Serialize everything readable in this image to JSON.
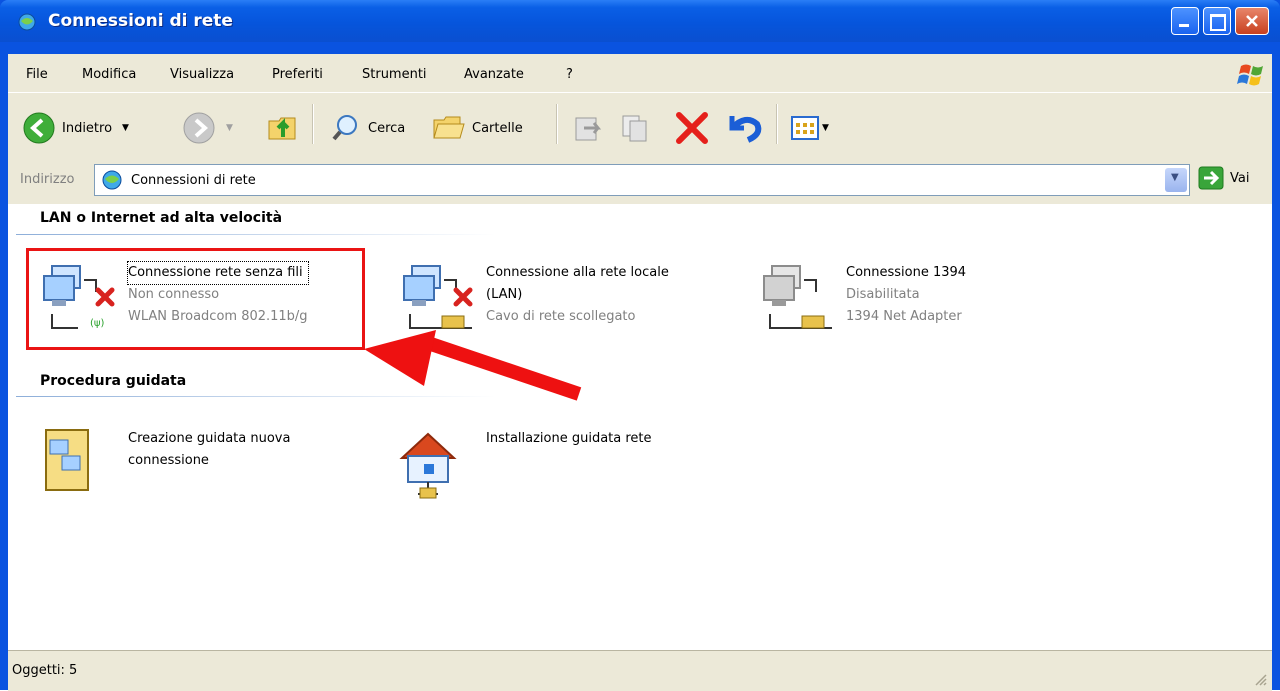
{
  "window": {
    "title": "Connessioni di rete"
  },
  "menu": [
    "File",
    "Modifica",
    "Visualizza",
    "Preferiti",
    "Strumenti",
    "Avanzate",
    "?"
  ],
  "toolbar": {
    "back_label": "Indietro",
    "search_label": "Cerca",
    "folders_label": "Cartelle"
  },
  "address": {
    "label": "Indirizzo",
    "value": "Connessioni di rete",
    "go_label": "Vai"
  },
  "groups": [
    {
      "title": "LAN o Internet ad alta velocità",
      "items": [
        {
          "title": "Connessione rete senza fili",
          "status": "Non connesso",
          "device": "WLAN Broadcom 802.11b/g"
        },
        {
          "title": "Connessione alla rete locale",
          "title2": "(LAN)",
          "status": "Cavo di rete scollegato"
        },
        {
          "title": "Connessione 1394",
          "status": "Disabilitata",
          "device": "1394 Net Adapter"
        }
      ]
    },
    {
      "title": "Procedura guidata",
      "items": [
        {
          "title": "Creazione guidata nuova",
          "title2": "connessione"
        },
        {
          "title": "Installazione guidata rete"
        }
      ]
    }
  ],
  "status": {
    "text": "Oggetti: 5"
  },
  "colors": {
    "title_bar": "#0a5fe6",
    "highlight": "#ea1414",
    "arrow": "#ee1111",
    "chrome": "#ece9d8"
  }
}
